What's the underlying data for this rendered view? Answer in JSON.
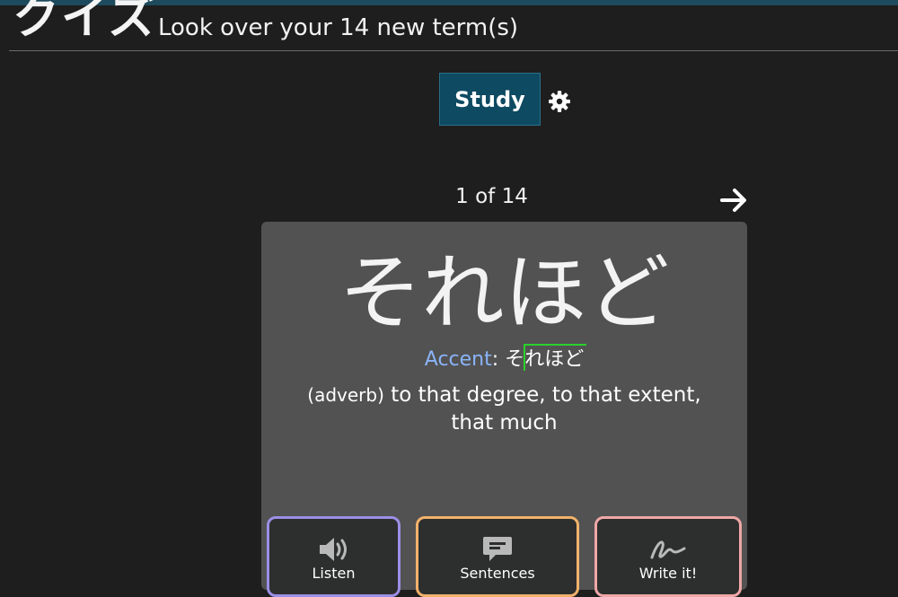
{
  "header": {
    "brand": "クイズ",
    "subtitle": "Look over your 14 new term(s)"
  },
  "toolbar": {
    "study_label": "Study",
    "settings_icon": "gear-icon"
  },
  "navigation": {
    "counter": "1 of 14",
    "next_icon": "arrow-right-icon"
  },
  "card": {
    "term": "それほど",
    "accent": {
      "label": "Accent",
      "separator": ": ",
      "prefix": "そ",
      "highlighted": "れほど"
    },
    "definition": {
      "part_of_speech": "(adverb)",
      "text": " to that degree, to that extent, that much"
    },
    "tools": [
      {
        "label": "Listen",
        "icon": "speaker-icon",
        "color": "#9b8fe6"
      },
      {
        "label": "Sentences",
        "icon": "speech-bubble-icon",
        "color": "#f2b26b"
      },
      {
        "label": "Write it!",
        "icon": "handwriting-icon",
        "color": "#f0a7a7"
      }
    ]
  },
  "colors": {
    "background": "#1e1e1e",
    "top_bar": "#1d4a5c",
    "study_button": "#0e4a62",
    "card": "#525252",
    "accent_label": "#8ab4f8",
    "accent_mark": "#2bd12b"
  }
}
